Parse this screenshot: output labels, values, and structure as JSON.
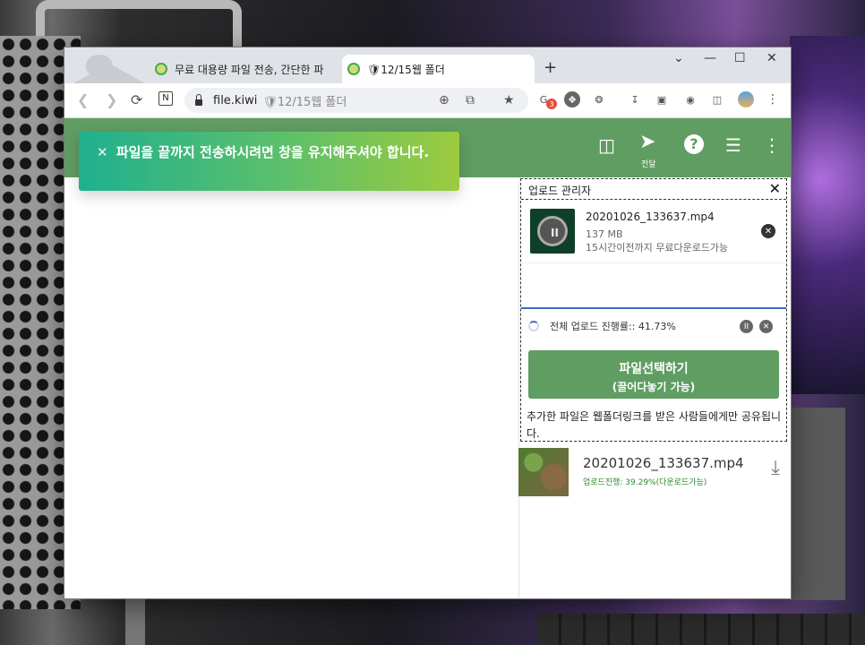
{
  "browser": {
    "tabs": [
      {
        "label": "무료 대용량 파일 전송, 간단한 파"
      },
      {
        "label": "🛡12/15웹 폴더"
      }
    ],
    "new_tab": "+",
    "controls": {
      "minimize": "—",
      "maximize": "☐",
      "close": "✕",
      "tab_list": "⌄"
    },
    "address": {
      "host": "file.kiwi",
      "page_title": "🛡12/15웹 폴더"
    },
    "extension_badge": "3"
  },
  "app": {
    "toast": {
      "close": "✕",
      "message": "파일을 끝까지 전송하시려면 창을 유지해주셔야 합니다."
    },
    "toolbar": {
      "share_label": "전달"
    },
    "upload_manager": {
      "title": "업로드 관리자",
      "close": "✕",
      "file": {
        "name": "20201026_133637.mp4",
        "size": "137 MB",
        "expiry": "15시간이전까지 무료다운로드가능"
      },
      "overall_progress_label": "전체 업로드 진행률:: 41.73%",
      "overall_progress_percent": 41.73,
      "select_button": {
        "line1": "파일선택하기",
        "line2": "(끌어다놓기 가능)"
      },
      "notice": "추가한 파일은 웹폴더링크를 받은 사람들에게만 공유됩니다."
    },
    "files": [
      {
        "name": "20201026_133637.mp4",
        "status": "업로드진행: 39.29%(다운로드가능)",
        "progress_percent": 39.29
      }
    ]
  },
  "colors": {
    "brand_green": "#5f9d62",
    "accent_blue": "#3b6fc0"
  }
}
